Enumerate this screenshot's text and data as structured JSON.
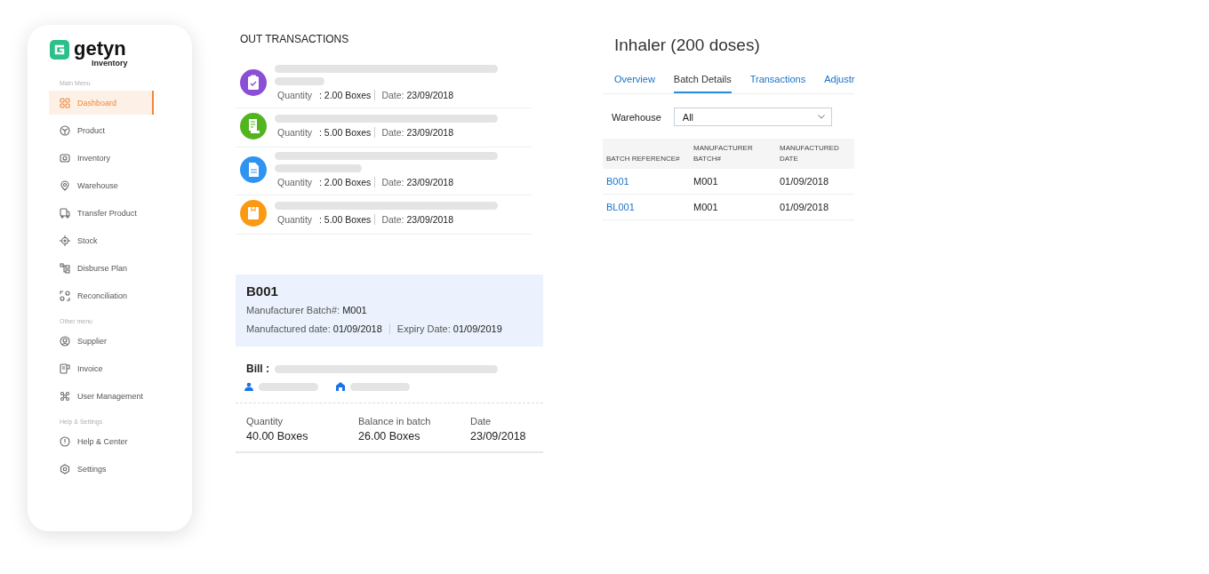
{
  "sidebar": {
    "logo": {
      "name": "getyn",
      "subtitle": "Inventory"
    },
    "sections": [
      {
        "title": "Main Menu",
        "items": [
          {
            "label": "Dashboard",
            "selected": true
          },
          {
            "label": "Product",
            "selected": false
          },
          {
            "label": "Inventory",
            "selected": false
          },
          {
            "label": "Warehouse",
            "selected": false
          },
          {
            "label": "Transfer Product",
            "selected": false
          },
          {
            "label": "Stock",
            "selected": false
          },
          {
            "label": "Disburse Plan",
            "selected": false
          },
          {
            "label": "Reconciliation",
            "selected": false
          }
        ]
      },
      {
        "title": "Other menu",
        "items": [
          {
            "label": "Supplier",
            "selected": false
          },
          {
            "label": "Invoice",
            "selected": false
          },
          {
            "label": "User Management",
            "selected": false
          }
        ]
      },
      {
        "title": "Help & Settings",
        "items": [
          {
            "label": "Help & Center",
            "selected": false
          },
          {
            "label": "Settings",
            "selected": false
          }
        ]
      }
    ]
  },
  "out_transactions": {
    "title": "OUT TRANSACTIONS",
    "items": [
      {
        "kind": "clipboard",
        "color": "#8a4fd6",
        "lines": [
          {
            "kind": "long"
          },
          {
            "kind": "short"
          }
        ],
        "quantity_label": "Quantity",
        "quantity": ": 2.00 Boxes",
        "date_label": "Date:",
        "date": "23/09/2018"
      },
      {
        "kind": "receipt",
        "color": "#52b51f",
        "lines": [
          {
            "kind": "long"
          }
        ],
        "quantity_label": "Quantity",
        "quantity": ": 5.00 Boxes",
        "date_label": "Date:",
        "date": "23/09/2018"
      },
      {
        "kind": "document",
        "color": "#2f93f2",
        "lines": [
          {
            "kind": "long"
          },
          {
            "kind": "medium"
          }
        ],
        "quantity_label": "Quantity",
        "quantity": ": 2.00 Boxes",
        "date_label": "Date:",
        "date": "23/09/2018"
      },
      {
        "kind": "box",
        "color": "#fb9a12",
        "lines": [
          {
            "kind": "long"
          }
        ],
        "quantity_label": "Quantity",
        "quantity": ": 5.00 Boxes",
        "date_label": "Date:",
        "date": "23/09/2018"
      }
    ]
  },
  "batch_card": {
    "title": "B001",
    "manufacturer_batch_label": "Manufacturer Batch#:",
    "manufacturer_batch": "M001",
    "manufactured_label": "Manufactured date:",
    "manufactured": "01/09/2018",
    "expiry_label": "Expiry Date:",
    "expiry": "01/09/2019",
    "bill_label": "Bill :",
    "stats": [
      {
        "label": "Quantity",
        "value": "40.00 Boxes"
      },
      {
        "label": "Balance in batch",
        "value": "26.00 Boxes"
      },
      {
        "label": "Date",
        "value": "23/09/2018"
      }
    ]
  },
  "product": {
    "title": "Inhaler (200 doses)",
    "tabs": [
      {
        "label": "Overview",
        "selected": false
      },
      {
        "label": "Batch Details",
        "selected": true
      },
      {
        "label": "Transactions",
        "selected": false
      },
      {
        "label": "Adjustr",
        "selected": false
      }
    ],
    "warehouse_label": "Warehouse",
    "warehouse_value": "All",
    "table": {
      "columns": [
        "BATCH REFERENCE#",
        "MANUFACTURER BATCH#",
        "MANUFACTURED DATE"
      ],
      "rows": [
        [
          "B001",
          "M001",
          "01/09/2018"
        ],
        [
          "BL001",
          "M001",
          "01/09/2018"
        ]
      ]
    }
  }
}
